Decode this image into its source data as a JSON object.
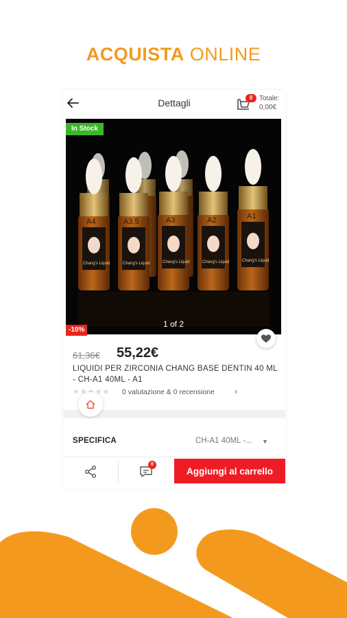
{
  "promo": {
    "title_bold": "ACQUISTA",
    "title_light": "ONLINE"
  },
  "colors": {
    "accent": "#f39a1e",
    "sale": "#ee1c25",
    "stock": "#3cb72a"
  },
  "header": {
    "title": "Dettagli",
    "cart_count": "0",
    "total_label": "Totale:",
    "total_value": "0,00€",
    "icons": {
      "back": "arrow-left-icon",
      "cart": "cart-icon"
    }
  },
  "product": {
    "stock_badge": "In Stock",
    "image_counter": "1 of 2",
    "discount": "-10%",
    "old_price": "61,36€",
    "new_price": "55,22€",
    "name": "LIQUIDI PER ZIRCONIA CHANG BASE DENTIN 40 ML - CH-A1 40ML - A1",
    "rating_stars": "★★★★★",
    "reviews_text": "0 valutazione & 0 recensione",
    "bottle_labels": [
      "A4",
      "A3.5",
      "A3",
      "A2",
      "A1"
    ],
    "bottle_brand": "Chang's Liquid"
  },
  "spec": {
    "label": "SPECIFICA",
    "value": "CH-A1 40ML -..."
  },
  "actions": {
    "chat_count": "0",
    "add_to_cart": "Aggiungi al carrello"
  }
}
